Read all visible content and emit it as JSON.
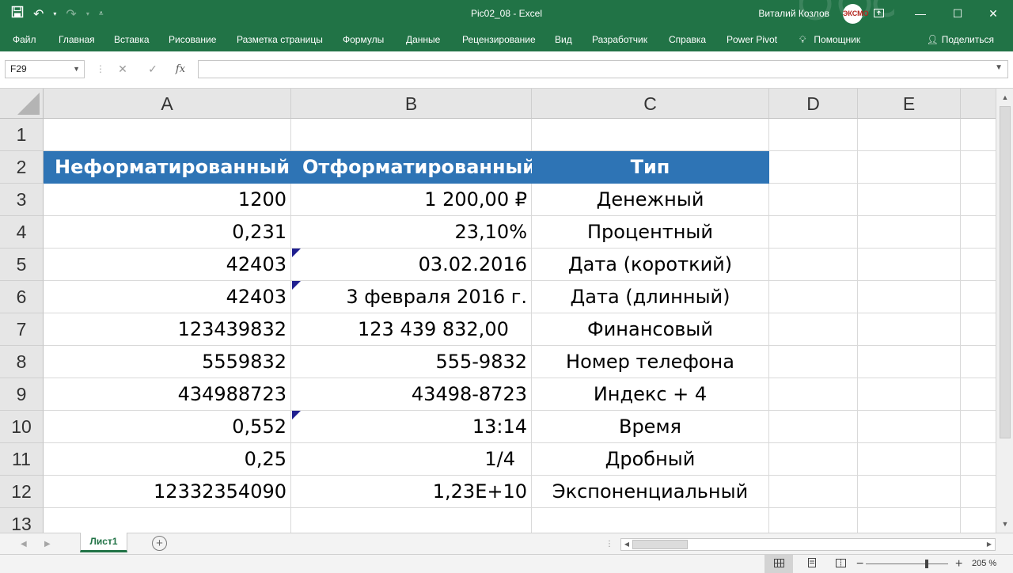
{
  "window": {
    "title": "Pic02_08  -  Excel",
    "user_name": "Виталий Козлов",
    "avatar_text": "ЭКСМО"
  },
  "ribbon_tabs": [
    "Файл",
    "Главная",
    "Вставка",
    "Рисование",
    "Разметка страницы",
    "Формулы",
    "Данные",
    "Рецензирование",
    "Вид",
    "Разработчик",
    "Справка",
    "Power Pivot",
    "Помощник"
  ],
  "share_label": "Поделиться",
  "formula_bar": {
    "name_box": "F29",
    "formula": ""
  },
  "columns": [
    "A",
    "B",
    "C",
    "D",
    "E"
  ],
  "rows": [
    "1",
    "2",
    "3",
    "4",
    "5",
    "6",
    "7",
    "8",
    "9",
    "10",
    "11",
    "12",
    "13"
  ],
  "table": {
    "headers": [
      "Неформатированный",
      "Отформатированный",
      "Тип"
    ],
    "rows": [
      [
        "1200",
        "1 200,00 ₽",
        "Денежный"
      ],
      [
        "0,231",
        "23,10%",
        "Процентный"
      ],
      [
        "42403",
        "03.02.2016",
        "Дата (короткий)"
      ],
      [
        "42403",
        "3 февраля 2016 г.",
        "Дата (длинный)"
      ],
      [
        "123439832",
        "123 439 832,00 ",
        "Финансовый"
      ],
      [
        "5559832",
        "555-9832",
        "Номер телефона"
      ],
      [
        "434988723",
        "43498-8723",
        "Индекс + 4"
      ],
      [
        "0,552",
        "13:14",
        "Время"
      ],
      [
        "0,25",
        "1/4 ",
        "Дробный"
      ],
      [
        "12332354090",
        "1,23E+10",
        "Экспоненциальный"
      ]
    ]
  },
  "sheets": [
    "Лист1"
  ],
  "status": {
    "zoom": "205 %",
    "zoom_value": 205
  },
  "colors": {
    "excel_green": "#217346",
    "header_fill": "#2e74b5",
    "comment_flag": "#1f1f8f"
  }
}
